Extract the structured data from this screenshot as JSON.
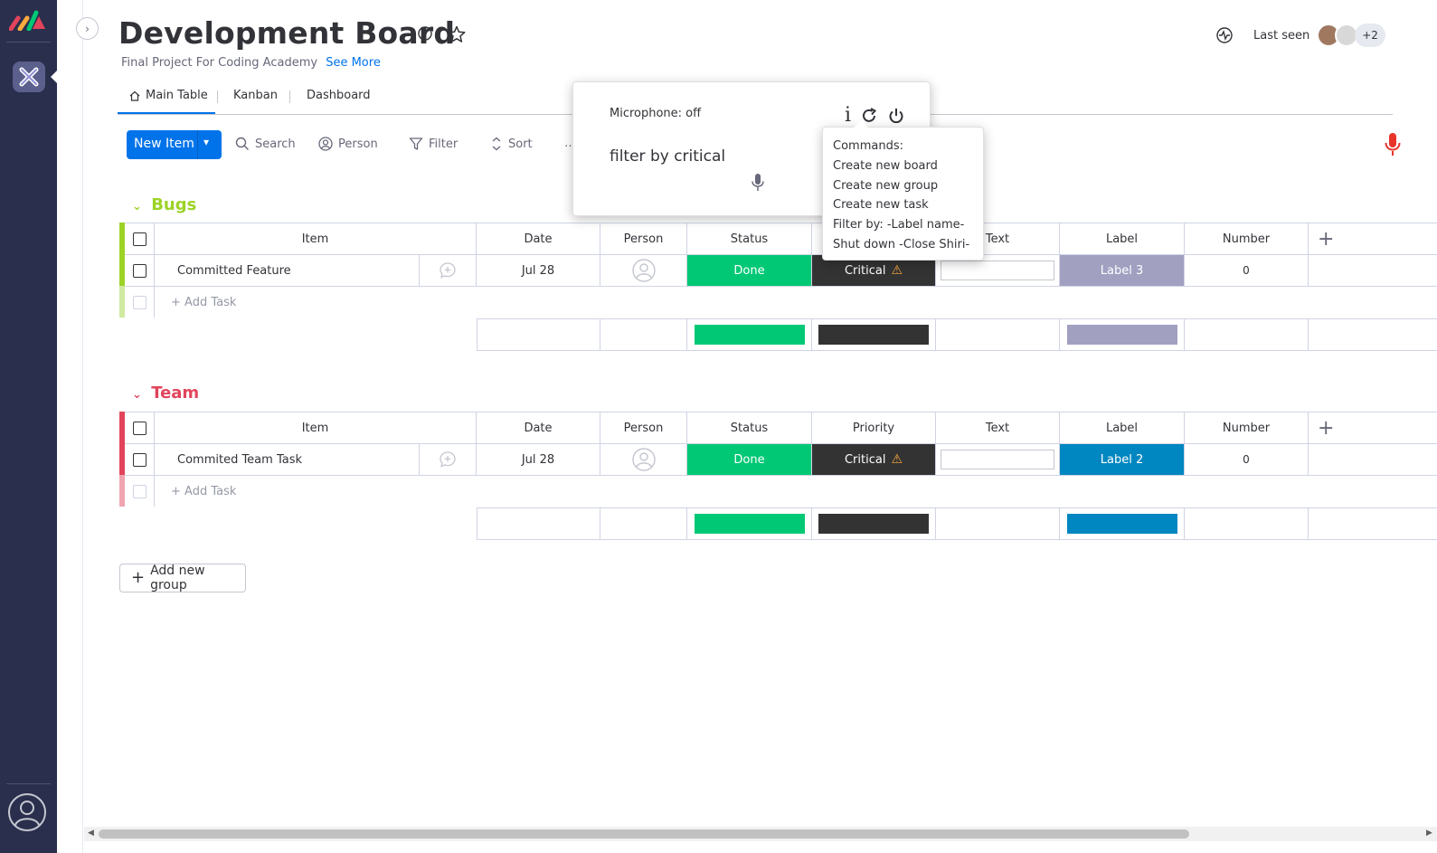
{
  "colors": {
    "sidebar_bg": "#292f4c",
    "primary": "#0073ea",
    "bugs_group": "#9cd326",
    "team_group": "#e2445c",
    "status_done": "#00c875",
    "priority_critical": "#333333",
    "label3": "#a1a0c1",
    "label2": "#0086c0",
    "critical_warning": "#fdab3d",
    "mic_active": "#e8332a"
  },
  "board": {
    "title": "Development Board",
    "description": "Final Project For Coding Academy",
    "see_more": "See More"
  },
  "header_right": {
    "last_seen": "Last seen",
    "extra_count": "+2"
  },
  "tabs": [
    {
      "label": "Main Table",
      "icon": "home-icon",
      "active": true
    },
    {
      "label": "Kanban"
    },
    {
      "label": "Dashboard"
    }
  ],
  "toolbar": {
    "new_item": "New Item",
    "search": "Search",
    "person": "Person",
    "filter": "Filter",
    "sort": "Sort",
    "more": "…"
  },
  "columns": [
    "Item",
    "Date",
    "Person",
    "Status",
    "Priority",
    "Text",
    "Label",
    "Number"
  ],
  "groups": [
    {
      "title": "Bugs",
      "color": "#9cd326",
      "tasks": [
        {
          "item": "Committed Feature",
          "date": "Jul 28",
          "status": "Done",
          "priority": "Critical",
          "text": "",
          "label": "Label 3",
          "number": "0"
        }
      ],
      "add_task": "+ Add Task"
    },
    {
      "title": "Team",
      "color": "#e2445c",
      "tasks": [
        {
          "item": "Commited Team Task",
          "date": "Jul 28",
          "status": "Done",
          "priority": "Critical",
          "text": "",
          "label": "Label 2",
          "number": "0"
        }
      ],
      "add_task": "+ Add Task"
    }
  ],
  "add_group": "Add new group",
  "voice_panel": {
    "microphone_status": "Microphone: off",
    "transcript": "filter by critical"
  },
  "commands_panel": {
    "heading": "Commands:",
    "items": [
      "Create new board",
      "Create new group",
      "Create new task",
      "Filter by: -Label name-",
      "Shut down -Close Shiri-"
    ]
  }
}
